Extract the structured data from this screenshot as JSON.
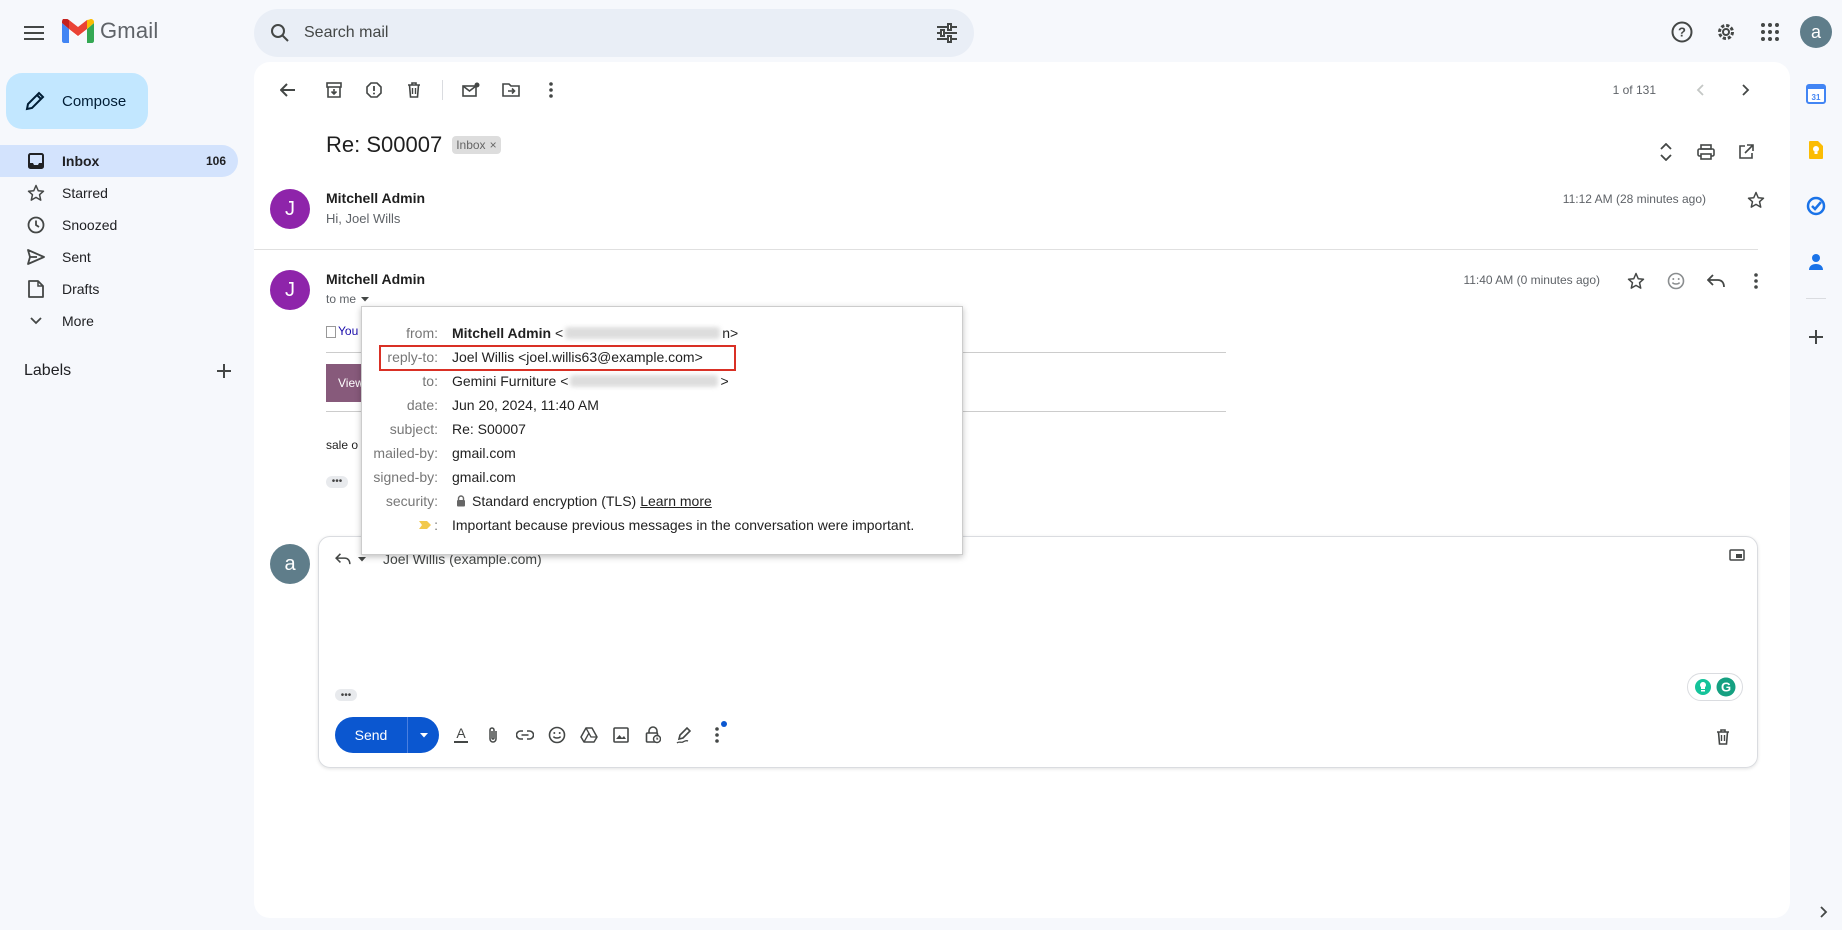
{
  "app": {
    "name": "Gmail"
  },
  "search": {
    "placeholder": "Search mail"
  },
  "account": {
    "initial": "a"
  },
  "compose": {
    "label": "Compose"
  },
  "nav": {
    "items": [
      {
        "label": "Inbox",
        "count": "106"
      },
      {
        "label": "Starred"
      },
      {
        "label": "Snoozed"
      },
      {
        "label": "Sent"
      },
      {
        "label": "Drafts"
      },
      {
        "label": "More"
      }
    ]
  },
  "labels": {
    "title": "Labels"
  },
  "pager": {
    "text": "1 of 131"
  },
  "thread": {
    "subject": "Re: S00007",
    "chip": "Inbox",
    "chip_close": "×"
  },
  "messages": [
    {
      "initial": "J",
      "sender": "Mitchell Admin",
      "snippet": "Hi, Joel Wills",
      "time": "11:12 AM (28 minutes ago)"
    },
    {
      "initial": "J",
      "sender": "Mitchell Admin",
      "to": "to me",
      "time": "11:40 AM (0 minutes ago)",
      "body_img_alt": "You",
      "view_btn": "View",
      "body_text": "sale o",
      "dots": "•••"
    }
  ],
  "details": {
    "from_label": "from:",
    "from_name": "Mitchell Admin",
    "from_lt": "<",
    "from_gt": "n>",
    "reply_label": "reply-to:",
    "reply_value": "Joel Willis <joel.willis63@example.com>",
    "to_label": "to:",
    "to_name": "Gemini Furniture",
    "to_lt": "<",
    "to_gt": ">",
    "date_label": "date:",
    "date_value": "Jun 20, 2024, 11:40 AM",
    "subject_label": "subject:",
    "subject_value": "Re: S00007",
    "mailed_label": "mailed-by:",
    "mailed_value": "gmail.com",
    "signed_label": "signed-by:",
    "signed_value": "gmail.com",
    "security_label": "security:",
    "security_value": "Standard encryption (TLS)",
    "security_link": "Learn more",
    "important_colon": ":",
    "important_value": "Important because previous messages in the conversation were important."
  },
  "reply": {
    "initial": "a",
    "recipient": "Joel Willis (example.com)",
    "dots": "•••",
    "send_label": "Send"
  },
  "colors": {
    "accent": "#0b57d0",
    "compose_bg": "#c2e7ff",
    "active_nav": "#d3e3fd",
    "avatar_j": "#8e24aa",
    "highlight": "#d93025"
  }
}
